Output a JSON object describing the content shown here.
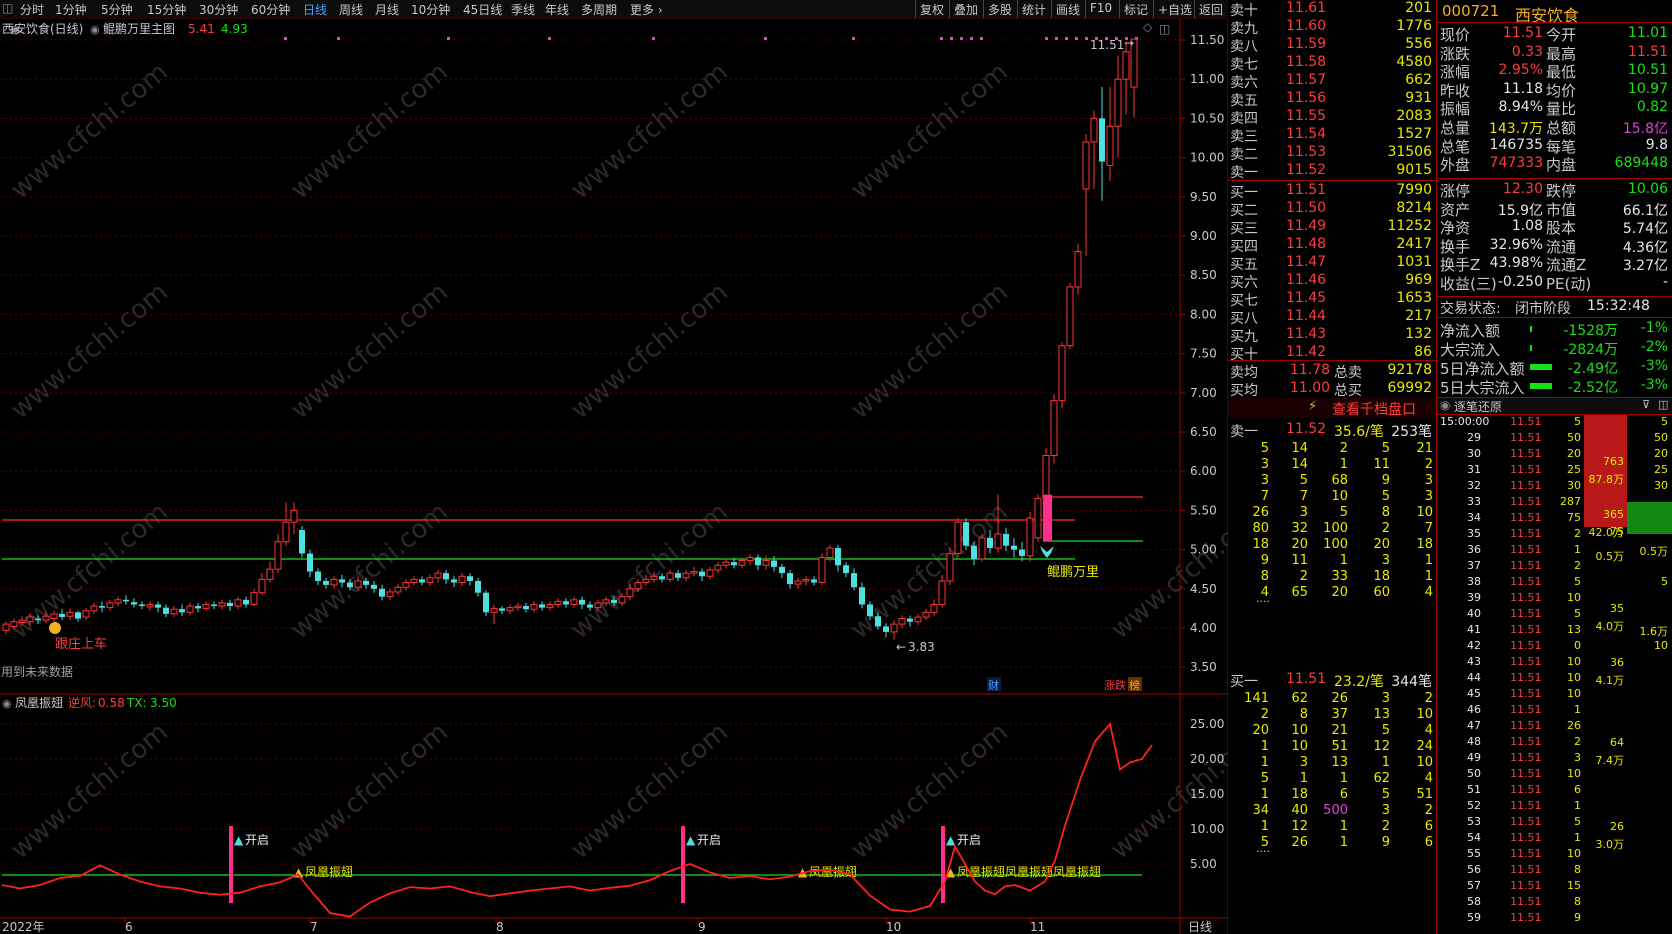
{
  "toolbar": {
    "periods": [
      "分时",
      "1分钟",
      "5分钟",
      "15分钟",
      "30分钟",
      "60分钟",
      "日线",
      "周线",
      "月线",
      "10分钟",
      "45日线",
      "季线",
      "年线",
      "多周期",
      "更多"
    ],
    "active_period": "日线",
    "right_buttons": [
      "复权",
      "叠加",
      "多股",
      "统计",
      "画线",
      "F10",
      "+自选",
      "返回"
    ],
    "mark_label": "标记"
  },
  "main_chart": {
    "stock_label": "西安饮食(日线)",
    "indicator_label": "鲲鹏万里主图",
    "indicator_value1": "5.41",
    "indicator_value2": "4.93",
    "price_high_label": "11.51",
    "price_low_label": "3.83",
    "label_follow": "跟庄上车",
    "label_future": "用到未来数据",
    "label_kunpeng": "鲲鹏万里",
    "badge_cai": "财",
    "badge_zd": "涨跌",
    "badge_bang": "榜",
    "y_ticks": [
      "11.50",
      "11.00",
      "10.50",
      "10.00",
      "9.50",
      "9.00",
      "8.50",
      "8.00",
      "7.50",
      "7.00",
      "6.50",
      "6.00",
      "5.50",
      "5.00",
      "4.50",
      "4.00",
      "3.50"
    ]
  },
  "sub_chart": {
    "name": "凤凰振翅",
    "ni_feng_label": "逆风:",
    "ni_feng_value": "0.58",
    "tx_label": "TX:",
    "tx_value": "3.50",
    "y_ticks": [
      "25.00",
      "20.00",
      "15.00",
      "10.00",
      "5.00"
    ],
    "open_label": "开启",
    "phoenix_label": "凤凰振翅",
    "phoenix_label_multi": "凤凰振翅凤凰振翅凤凰振翅"
  },
  "x_axis": {
    "labels": [
      "2022年",
      "6",
      "7",
      "8",
      "9",
      "10",
      "11"
    ],
    "period_label": "日线"
  },
  "order_book": {
    "sells": [
      {
        "label": "卖十",
        "price": "11.61",
        "vol": "201"
      },
      {
        "label": "卖九",
        "price": "11.60",
        "vol": "1776"
      },
      {
        "label": "卖八",
        "price": "11.59",
        "vol": "556"
      },
      {
        "label": "卖七",
        "price": "11.58",
        "vol": "4580"
      },
      {
        "label": "卖六",
        "price": "11.57",
        "vol": "662"
      },
      {
        "label": "卖五",
        "price": "11.56",
        "vol": "931"
      },
      {
        "label": "卖四",
        "price": "11.55",
        "vol": "2083"
      },
      {
        "label": "卖三",
        "price": "11.54",
        "vol": "1527"
      },
      {
        "label": "卖二",
        "price": "11.53",
        "vol": "31506"
      },
      {
        "label": "卖一",
        "price": "11.52",
        "vol": "9015"
      }
    ],
    "buys": [
      {
        "label": "买一",
        "price": "11.51",
        "vol": "7990"
      },
      {
        "label": "买二",
        "price": "11.50",
        "vol": "8214"
      },
      {
        "label": "买三",
        "price": "11.49",
        "vol": "11252"
      },
      {
        "label": "买四",
        "price": "11.48",
        "vol": "2417"
      },
      {
        "label": "买五",
        "price": "11.47",
        "vol": "1031"
      },
      {
        "label": "买六",
        "price": "11.46",
        "vol": "969"
      },
      {
        "label": "买七",
        "price": "11.45",
        "vol": "1653"
      },
      {
        "label": "买八",
        "price": "11.44",
        "vol": "217"
      },
      {
        "label": "买九",
        "price": "11.43",
        "vol": "132"
      },
      {
        "label": "买十",
        "price": "11.42",
        "vol": "86"
      }
    ],
    "avg_sell_label": "卖均",
    "avg_sell_price": "11.78",
    "total_sell_label": "总卖",
    "total_sell": "92178",
    "avg_buy_label": "买均",
    "avg_buy_price": "11.00",
    "total_buy_label": "总买",
    "total_buy": "69992",
    "thousand_link": "查看千档盘口"
  },
  "queue": {
    "sell1": {
      "label": "卖一",
      "price": "11.52",
      "per": "35.6/笔",
      "count": "253笔"
    },
    "sell_rows": [
      [
        "5",
        "14",
        "2",
        "5",
        "21"
      ],
      [
        "3",
        "14",
        "1",
        "11",
        "2"
      ],
      [
        "3",
        "5",
        "68",
        "9",
        "3"
      ],
      [
        "7",
        "7",
        "10",
        "5",
        "3"
      ],
      [
        "26",
        "3",
        "5",
        "8",
        "10"
      ],
      [
        "80",
        "32",
        "100",
        "2",
        "7"
      ],
      [
        "18",
        "20",
        "100",
        "20",
        "18"
      ],
      [
        "9",
        "11",
        "1",
        "3",
        "1"
      ],
      [
        "8",
        "2",
        "33",
        "18",
        "1"
      ],
      [
        "4",
        "65",
        "20",
        "60",
        "4"
      ]
    ],
    "buy1": {
      "label": "买一",
      "price": "11.51",
      "per": "23.2/笔",
      "count": "344笔"
    },
    "buy_rows": [
      [
        "141",
        "62",
        "26",
        "3",
        "2"
      ],
      [
        "2",
        "8",
        "37",
        "13",
        "10"
      ],
      [
        "20",
        "10",
        "21",
        "5",
        "4"
      ],
      [
        "1",
        "10",
        "51",
        "12",
        "24"
      ],
      [
        "1",
        "3",
        "13",
        "1",
        "10"
      ],
      [
        "5",
        "1",
        "1",
        "62",
        "4"
      ],
      [
        "1",
        "18",
        "6",
        "5",
        "51"
      ],
      [
        "34",
        "40",
        "500",
        "3",
        "2"
      ],
      [
        "1",
        "12",
        "1",
        "2",
        "6"
      ],
      [
        "5",
        "26",
        "1",
        "9",
        "6"
      ]
    ],
    "ellipsis": "...."
  },
  "quote": {
    "code": "000721",
    "name": "西安饮食",
    "rows": [
      [
        {
          "l": "现价",
          "v": "11.51",
          "c": "#ff3b3b"
        },
        {
          "l": "今开",
          "v": "11.01",
          "c": "#18e018"
        }
      ],
      [
        {
          "l": "涨跌",
          "v": "0.33",
          "c": "#ff3b3b"
        },
        {
          "l": "最高",
          "v": "11.51",
          "c": "#ff3b3b"
        }
      ],
      [
        {
          "l": "涨幅",
          "v": "2.95%",
          "c": "#ff3b3b"
        },
        {
          "l": "最低",
          "v": "10.51",
          "c": "#18e018"
        }
      ],
      [
        {
          "l": "昨收",
          "v": "11.18",
          "c": "#e6e6e6"
        },
        {
          "l": "均价",
          "v": "10.97",
          "c": "#18e018"
        }
      ],
      [
        {
          "l": "振幅",
          "v": "8.94%",
          "c": "#e6e6e6"
        },
        {
          "l": "量比",
          "v": "0.82",
          "c": "#18e018"
        }
      ],
      [
        {
          "l": "总量",
          "v": "143.7万",
          "c": "#e8e800"
        },
        {
          "l": "总额",
          "v": "15.8亿",
          "c": "#e040e0"
        }
      ],
      [
        {
          "l": "总笔",
          "v": "146735",
          "c": "#e6e6e6"
        },
        {
          "l": "每笔",
          "v": "9.8",
          "c": "#e6e6e6"
        }
      ],
      [
        {
          "l": "外盘",
          "v": "747333",
          "c": "#ff3b3b"
        },
        {
          "l": "内盘",
          "v": "689448",
          "c": "#18e018"
        }
      ],
      [
        {
          "l": "涨停",
          "v": "12.30",
          "c": "#ff3b3b"
        },
        {
          "l": "跌停",
          "v": "10.06",
          "c": "#18e018"
        }
      ],
      [
        {
          "l": "资产",
          "v": "15.9亿",
          "c": "#e6e6e6"
        },
        {
          "l": "市值",
          "v": "66.1亿",
          "c": "#e6e6e6"
        }
      ],
      [
        {
          "l": "净资",
          "v": "1.08",
          "c": "#e6e6e6"
        },
        {
          "l": "股本",
          "v": "5.74亿",
          "c": "#e6e6e6"
        }
      ],
      [
        {
          "l": "换手",
          "v": "32.96%",
          "c": "#e6e6e6"
        },
        {
          "l": "流通",
          "v": "4.36亿",
          "c": "#e6e6e6"
        }
      ],
      [
        {
          "l": "换手Z",
          "v": "43.98%",
          "c": "#e6e6e6"
        },
        {
          "l": "流通Z",
          "v": "3.27亿",
          "c": "#e6e6e6"
        }
      ],
      [
        {
          "l": "收益(三)",
          "v": "-0.250",
          "c": "#e6e6e6"
        },
        {
          "l": "PE(动)",
          "v": "-",
          "c": "#e6e6e6"
        }
      ]
    ],
    "trade_status_label": "交易状态:",
    "trade_status": "闭市阶段",
    "trade_time": "15:32:48",
    "flows": [
      {
        "label": "净流入额",
        "value": "-1528万",
        "pct": "-1%",
        "bar": 0.01
      },
      {
        "label": "大宗流入",
        "value": "-2824万",
        "pct": "-2%",
        "bar": 0.01
      },
      {
        "label": "5日净流入额",
        "value": "-2.49亿",
        "pct": "-3%",
        "bar": 0.5
      },
      {
        "label": "5日大宗流入",
        "value": "-2.52亿",
        "pct": "-3%",
        "bar": 0.5
      }
    ]
  },
  "ticks": {
    "title": "逐笔还原",
    "first_time": "15:00:00",
    "rows": [
      {
        "t": "",
        "p": "11.51",
        "v": "5"
      },
      {
        "t": "29",
        "p": "11.51",
        "v": "50"
      },
      {
        "t": "30",
        "p": "11.51",
        "v": "20"
      },
      {
        "t": "31",
        "p": "11.51",
        "v": "25"
      },
      {
        "t": "32",
        "p": "11.51",
        "v": "30"
      },
      {
        "t": "33",
        "p": "11.51",
        "v": "287"
      },
      {
        "t": "34",
        "p": "11.51",
        "v": "75"
      },
      {
        "t": "35",
        "p": "11.51",
        "v": "2"
      },
      {
        "t": "36",
        "p": "11.51",
        "v": "1"
      },
      {
        "t": "37",
        "p": "11.51",
        "v": "2"
      },
      {
        "t": "38",
        "p": "11.51",
        "v": "5"
      },
      {
        "t": "39",
        "p": "11.51",
        "v": "10"
      },
      {
        "t": "40",
        "p": "11.51",
        "v": "5"
      },
      {
        "t": "41",
        "p": "11.51",
        "v": "13"
      },
      {
        "t": "42",
        "p": "11.51",
        "v": "0"
      },
      {
        "t": "43",
        "p": "11.51",
        "v": "10"
      },
      {
        "t": "44",
        "p": "11.51",
        "v": "10"
      },
      {
        "t": "45",
        "p": "11.51",
        "v": "10"
      },
      {
        "t": "46",
        "p": "11.51",
        "v": "1"
      },
      {
        "t": "47",
        "p": "11.51",
        "v": "26"
      },
      {
        "t": "48",
        "p": "11.51",
        "v": "2"
      },
      {
        "t": "49",
        "p": "11.51",
        "v": "3"
      },
      {
        "t": "50",
        "p": "11.51",
        "v": "10"
      },
      {
        "t": "51",
        "p": "11.51",
        "v": "6"
      },
      {
        "t": "52",
        "p": "11.51",
        "v": "1"
      },
      {
        "t": "53",
        "p": "11.51",
        "v": "5"
      },
      {
        "t": "54",
        "p": "11.51",
        "v": "1"
      },
      {
        "t": "55",
        "p": "11.51",
        "v": "10"
      },
      {
        "t": "56",
        "p": "11.51",
        "v": "8"
      },
      {
        "t": "57",
        "p": "11.51",
        "v": "15"
      },
      {
        "t": "58",
        "p": "11.51",
        "v": "8"
      },
      {
        "t": "59",
        "p": "11.51",
        "v": "9"
      }
    ],
    "col3": [
      "5",
      "50",
      "25",
      "20",
      "30",
      "",
      "",
      "",
      "",
      "",
      "",
      "",
      "",
      "",
      "",
      "",
      "",
      "",
      "",
      "",
      "",
      "",
      "",
      "",
      "",
      "",
      "",
      "",
      "",
      "",
      "",
      ""
    ],
    "agg": [
      {
        "a": "763",
        "b": "87.8万"
      },
      {
        "a": "365",
        "b": "42.0万"
      },
      {
        "a": "75",
        "b": ""
      },
      {
        "a": "0.5万",
        "b": ""
      },
      {
        "a": "35",
        "b": "4.0万"
      },
      {
        "a": "36",
        "b": "4.1万"
      },
      {
        "a": "64",
        "b": "7.4万"
      },
      {
        "a": "26",
        "b": "3.0万"
      }
    ],
    "far_right": [
      "5",
      "50",
      "20",
      "25",
      "30",
      "",
      "",
      "",
      "0.5万",
      "",
      "5",
      "",
      "",
      "1.6万",
      "10",
      "",
      "",
      "",
      "",
      "",
      "",
      "",
      "",
      "",
      "",
      "",
      "",
      "",
      "",
      "",
      "",
      ""
    ]
  }
}
